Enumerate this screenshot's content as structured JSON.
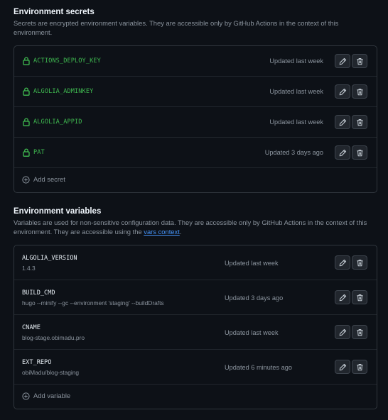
{
  "secrets_section": {
    "title": "Environment secrets",
    "description": "Secrets are encrypted environment variables. They are accessible only by GitHub Actions in the context of this environment.",
    "items": [
      {
        "name": "ACTIONS_DEPLOY_KEY",
        "updated": "Updated last week"
      },
      {
        "name": "ALGOLIA_ADMINKEY",
        "updated": "Updated last week"
      },
      {
        "name": "ALGOLIA_APPID",
        "updated": "Updated last week"
      },
      {
        "name": "PAT",
        "updated": "Updated 3 days ago"
      }
    ],
    "add_label": "Add secret"
  },
  "variables_section": {
    "title": "Environment variables",
    "description_before": "Variables are used for non-sensitive configuration data. They are accessible only by GitHub Actions in the context of this environment. They are accessible using the ",
    "link_text": "vars context",
    "description_after": ".",
    "items": [
      {
        "name": "ALGOLIA_VERSION",
        "value": "1.4.3",
        "updated": "Updated last week"
      },
      {
        "name": "BUILD_CMD",
        "value": "hugo --minify --gc --environment 'staging' --buildDrafts",
        "updated": "Updated 3 days ago"
      },
      {
        "name": "CNAME",
        "value": "blog-stage.obimadu.pro",
        "updated": "Updated last week"
      },
      {
        "name": "EXT_REPO",
        "value": "obiMadu/blog-staging",
        "updated": "Updated 6 minutes ago"
      }
    ],
    "add_label": "Add variable"
  },
  "icons": {
    "lock": "lock-icon",
    "edit": "pencil-icon",
    "delete": "trash-icon",
    "add": "plus-circle-icon"
  },
  "colors": {
    "background": "#0d1117",
    "border": "#30363d",
    "secret_name": "#3fb950",
    "muted": "#8b949e",
    "link": "#4493f8"
  }
}
